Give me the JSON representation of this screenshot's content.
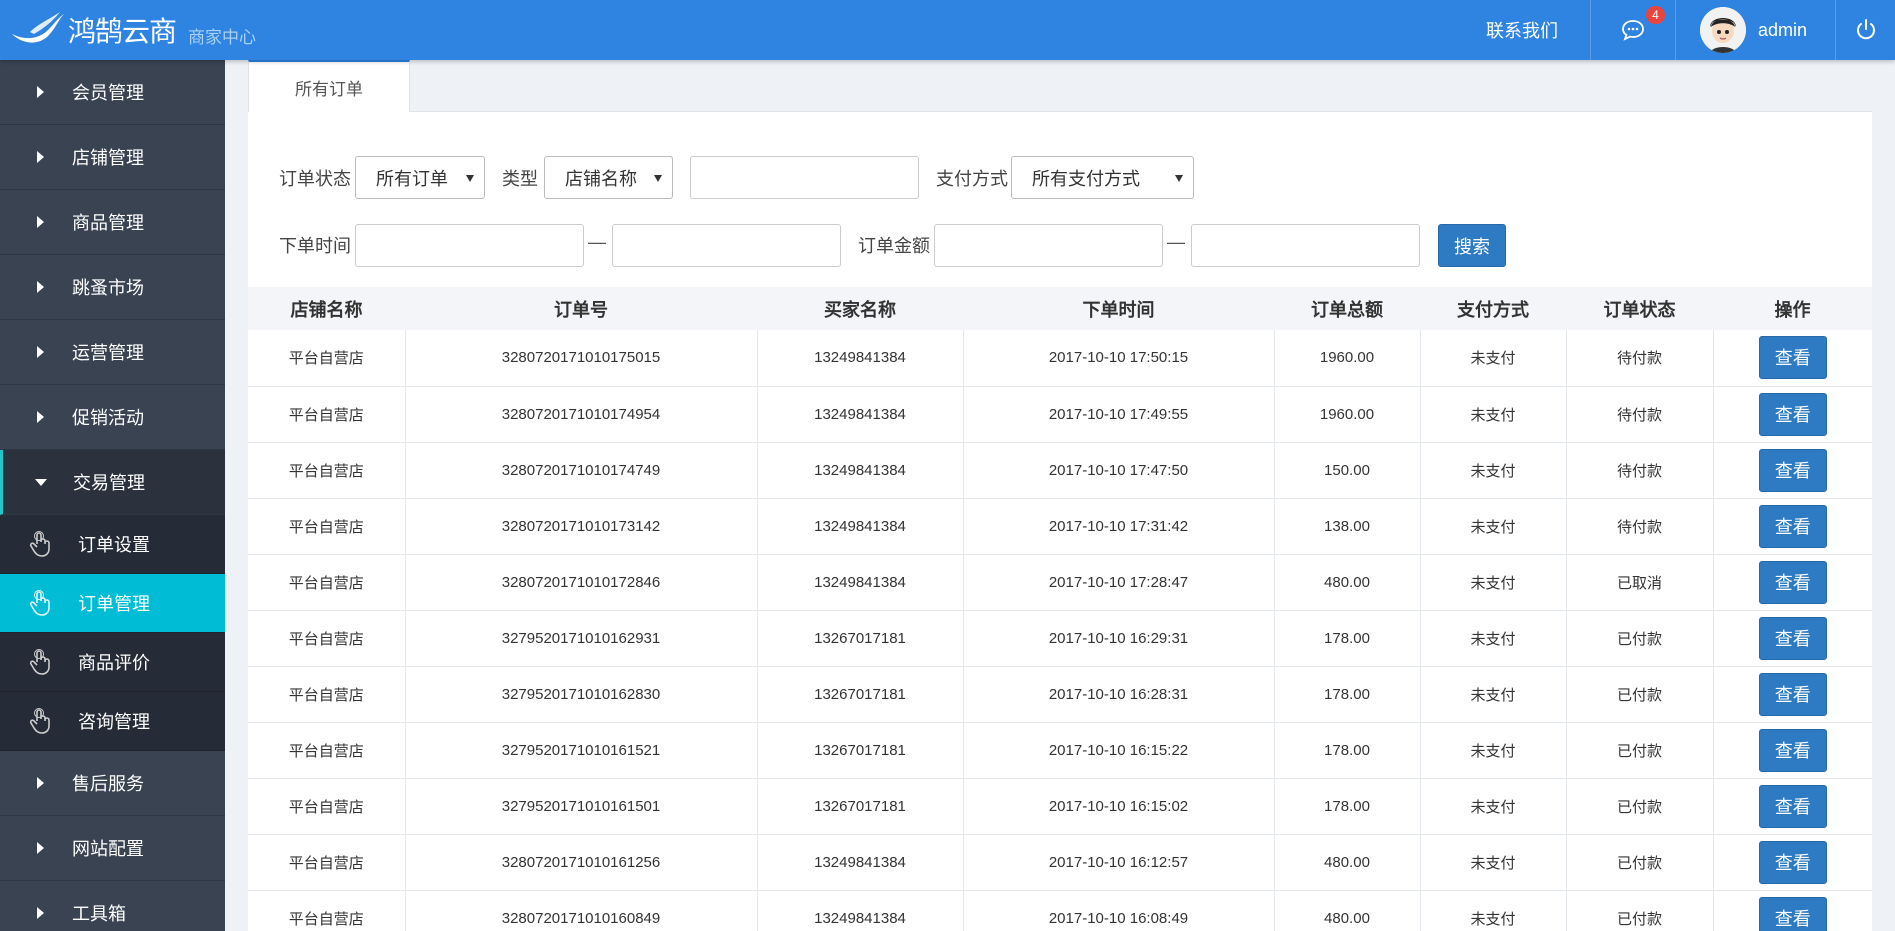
{
  "header": {
    "logo_text": "鸿鹄云商",
    "logo_sub": "商家中心",
    "contact": "联系我们",
    "message_count": "4",
    "username": "admin"
  },
  "sidebar": {
    "items": [
      {
        "label": "会员管理"
      },
      {
        "label": "店铺管理"
      },
      {
        "label": "商品管理"
      },
      {
        "label": "跳蚤市场"
      },
      {
        "label": "运营管理"
      },
      {
        "label": "促销活动"
      }
    ],
    "open_item": {
      "label": "交易管理"
    },
    "sub_items": [
      {
        "label": "订单设置"
      },
      {
        "label": "订单管理"
      },
      {
        "label": "商品评价"
      },
      {
        "label": "咨询管理"
      }
    ],
    "after_items": [
      {
        "label": "售后服务"
      },
      {
        "label": "网站配置"
      },
      {
        "label": "工具箱"
      }
    ]
  },
  "tabs": {
    "active": "所有订单"
  },
  "filters": {
    "order_status_label": "订单状态",
    "order_status_value": "所有订单",
    "type_label": "类型",
    "type_value": "店铺名称",
    "keyword_value": "",
    "pay_method_label": "支付方式",
    "pay_method_value": "所有支付方式",
    "order_time_label": "下单时间",
    "amount_label": "订单金额",
    "dash": "—",
    "search_label": "搜索"
  },
  "table": {
    "columns": [
      "店铺名称",
      "订单号",
      "买家名称",
      "下单时间",
      "订单总额",
      "支付方式",
      "订单状态",
      "操作"
    ],
    "view_label": "查看",
    "rows": [
      [
        "平台自营店",
        "3280720171010175015",
        "13249841384",
        "2017-10-10 17:50:15",
        "1960.00",
        "未支付",
        "待付款"
      ],
      [
        "平台自营店",
        "3280720171010174954",
        "13249841384",
        "2017-10-10 17:49:55",
        "1960.00",
        "未支付",
        "待付款"
      ],
      [
        "平台自营店",
        "3280720171010174749",
        "13249841384",
        "2017-10-10 17:47:50",
        "150.00",
        "未支付",
        "待付款"
      ],
      [
        "平台自营店",
        "3280720171010173142",
        "13249841384",
        "2017-10-10 17:31:42",
        "138.00",
        "未支付",
        "待付款"
      ],
      [
        "平台自营店",
        "3280720171010172846",
        "13249841384",
        "2017-10-10 17:28:47",
        "480.00",
        "未支付",
        "已取消"
      ],
      [
        "平台自营店",
        "3279520171010162931",
        "13267017181",
        "2017-10-10 16:29:31",
        "178.00",
        "未支付",
        "已付款"
      ],
      [
        "平台自营店",
        "3279520171010162830",
        "13267017181",
        "2017-10-10 16:28:31",
        "178.00",
        "未支付",
        "已付款"
      ],
      [
        "平台自营店",
        "3279520171010161521",
        "13267017181",
        "2017-10-10 16:15:22",
        "178.00",
        "未支付",
        "已付款"
      ],
      [
        "平台自营店",
        "3279520171010161501",
        "13267017181",
        "2017-10-10 16:15:02",
        "178.00",
        "未支付",
        "已付款"
      ],
      [
        "平台自营店",
        "3280720171010161256",
        "13249841384",
        "2017-10-10 16:12:57",
        "480.00",
        "未支付",
        "已付款"
      ],
      [
        "平台自营店",
        "3280720171010160849",
        "13249841384",
        "2017-10-10 16:08:49",
        "480.00",
        "未支付",
        "已付款"
      ]
    ]
  }
}
